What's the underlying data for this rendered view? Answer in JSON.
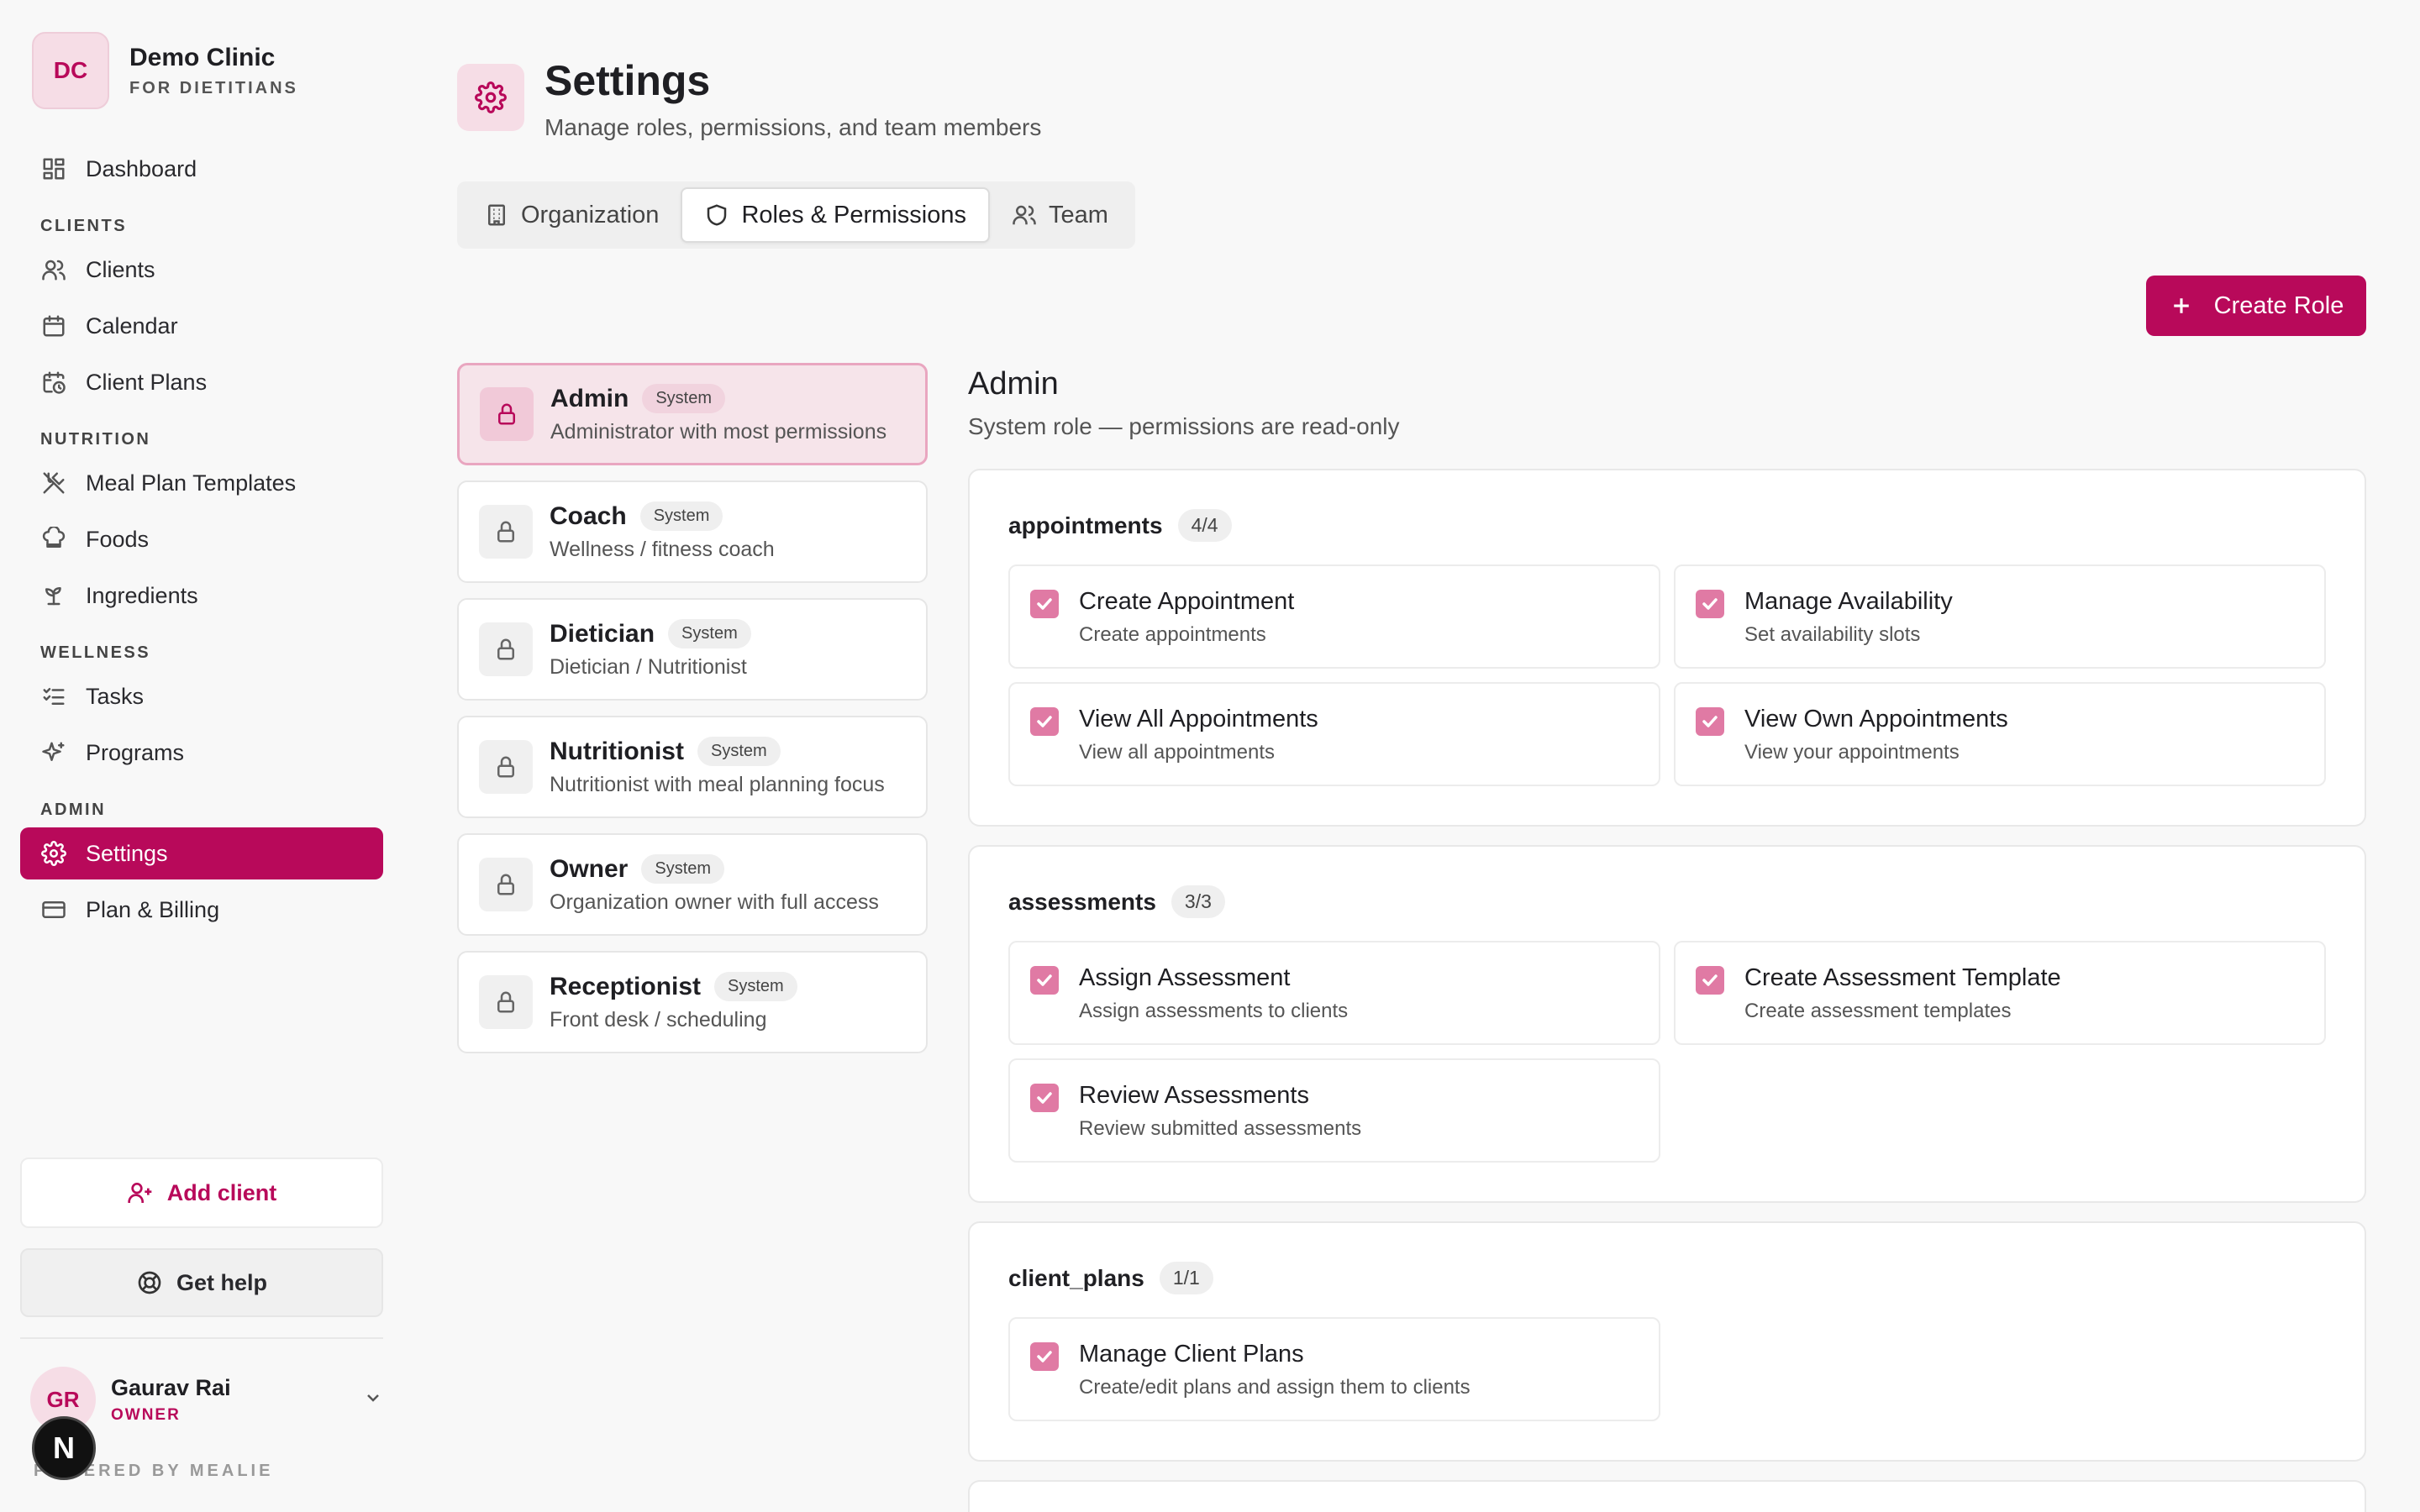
{
  "brand": {
    "initials": "DC",
    "name": "Demo Clinic",
    "subtitle": "FOR DIETITIANS"
  },
  "nav": {
    "dashboard": "Dashboard",
    "section_clients": "CLIENTS",
    "clients": "Clients",
    "calendar": "Calendar",
    "client_plans": "Client Plans",
    "section_nutrition": "NUTRITION",
    "meal_plan_templates": "Meal Plan Templates",
    "foods": "Foods",
    "ingredients": "Ingredients",
    "section_wellness": "WELLNESS",
    "tasks": "Tasks",
    "programs": "Programs",
    "section_admin": "ADMIN",
    "settings": "Settings",
    "plan_billing": "Plan & Billing"
  },
  "sidebar_actions": {
    "add_client": "Add client",
    "get_help": "Get help"
  },
  "user": {
    "initials": "GR",
    "name": "Gaurav Rai",
    "role": "OWNER"
  },
  "powered_by": "POWERED BY MEALIE",
  "n_badge": "N",
  "page": {
    "title": "Settings",
    "subtitle": "Manage roles, permissions, and team members"
  },
  "tabs": {
    "organization": "Organization",
    "roles": "Roles & Permissions",
    "team": "Team",
    "active": "Roles & Permissions"
  },
  "create_role": "Create Role",
  "roles": [
    {
      "name": "Admin",
      "badge": "System",
      "desc": "Administrator with most permissions"
    },
    {
      "name": "Coach",
      "badge": "System",
      "desc": "Wellness / fitness coach"
    },
    {
      "name": "Dietician",
      "badge": "System",
      "desc": "Dietician / Nutritionist"
    },
    {
      "name": "Nutritionist",
      "badge": "System",
      "desc": "Nutritionist with meal planning focus"
    },
    {
      "name": "Owner",
      "badge": "System",
      "desc": "Organization owner with full access"
    },
    {
      "name": "Receptionist",
      "badge": "System",
      "desc": "Front desk / scheduling"
    }
  ],
  "detail": {
    "title": "Admin",
    "subtitle": "System role — permissions are read-only"
  },
  "groups": [
    {
      "name": "appointments",
      "count": "4/4",
      "perms": [
        {
          "title": "Create Appointment",
          "desc": "Create appointments",
          "checked": true
        },
        {
          "title": "Manage Availability",
          "desc": "Set availability slots",
          "checked": true
        },
        {
          "title": "View All Appointments",
          "desc": "View all appointments",
          "checked": true
        },
        {
          "title": "View Own Appointments",
          "desc": "View your appointments",
          "checked": true
        }
      ]
    },
    {
      "name": "assessments",
      "count": "3/3",
      "perms": [
        {
          "title": "Assign Assessment",
          "desc": "Assign assessments to clients",
          "checked": true
        },
        {
          "title": "Create Assessment Template",
          "desc": "Create assessment templates",
          "checked": true
        },
        {
          "title": "Review Assessments",
          "desc": "Review submitted assessments",
          "checked": true
        }
      ]
    },
    {
      "name": "client_plans",
      "count": "1/1",
      "perms": [
        {
          "title": "Manage Client Plans",
          "desc": "Create/edit plans and assign them to clients",
          "checked": true
        }
      ]
    }
  ],
  "colors": {
    "accent": "#b8095a",
    "accent_soft": "#f6dde6",
    "checkbox": "#e07aa4"
  }
}
